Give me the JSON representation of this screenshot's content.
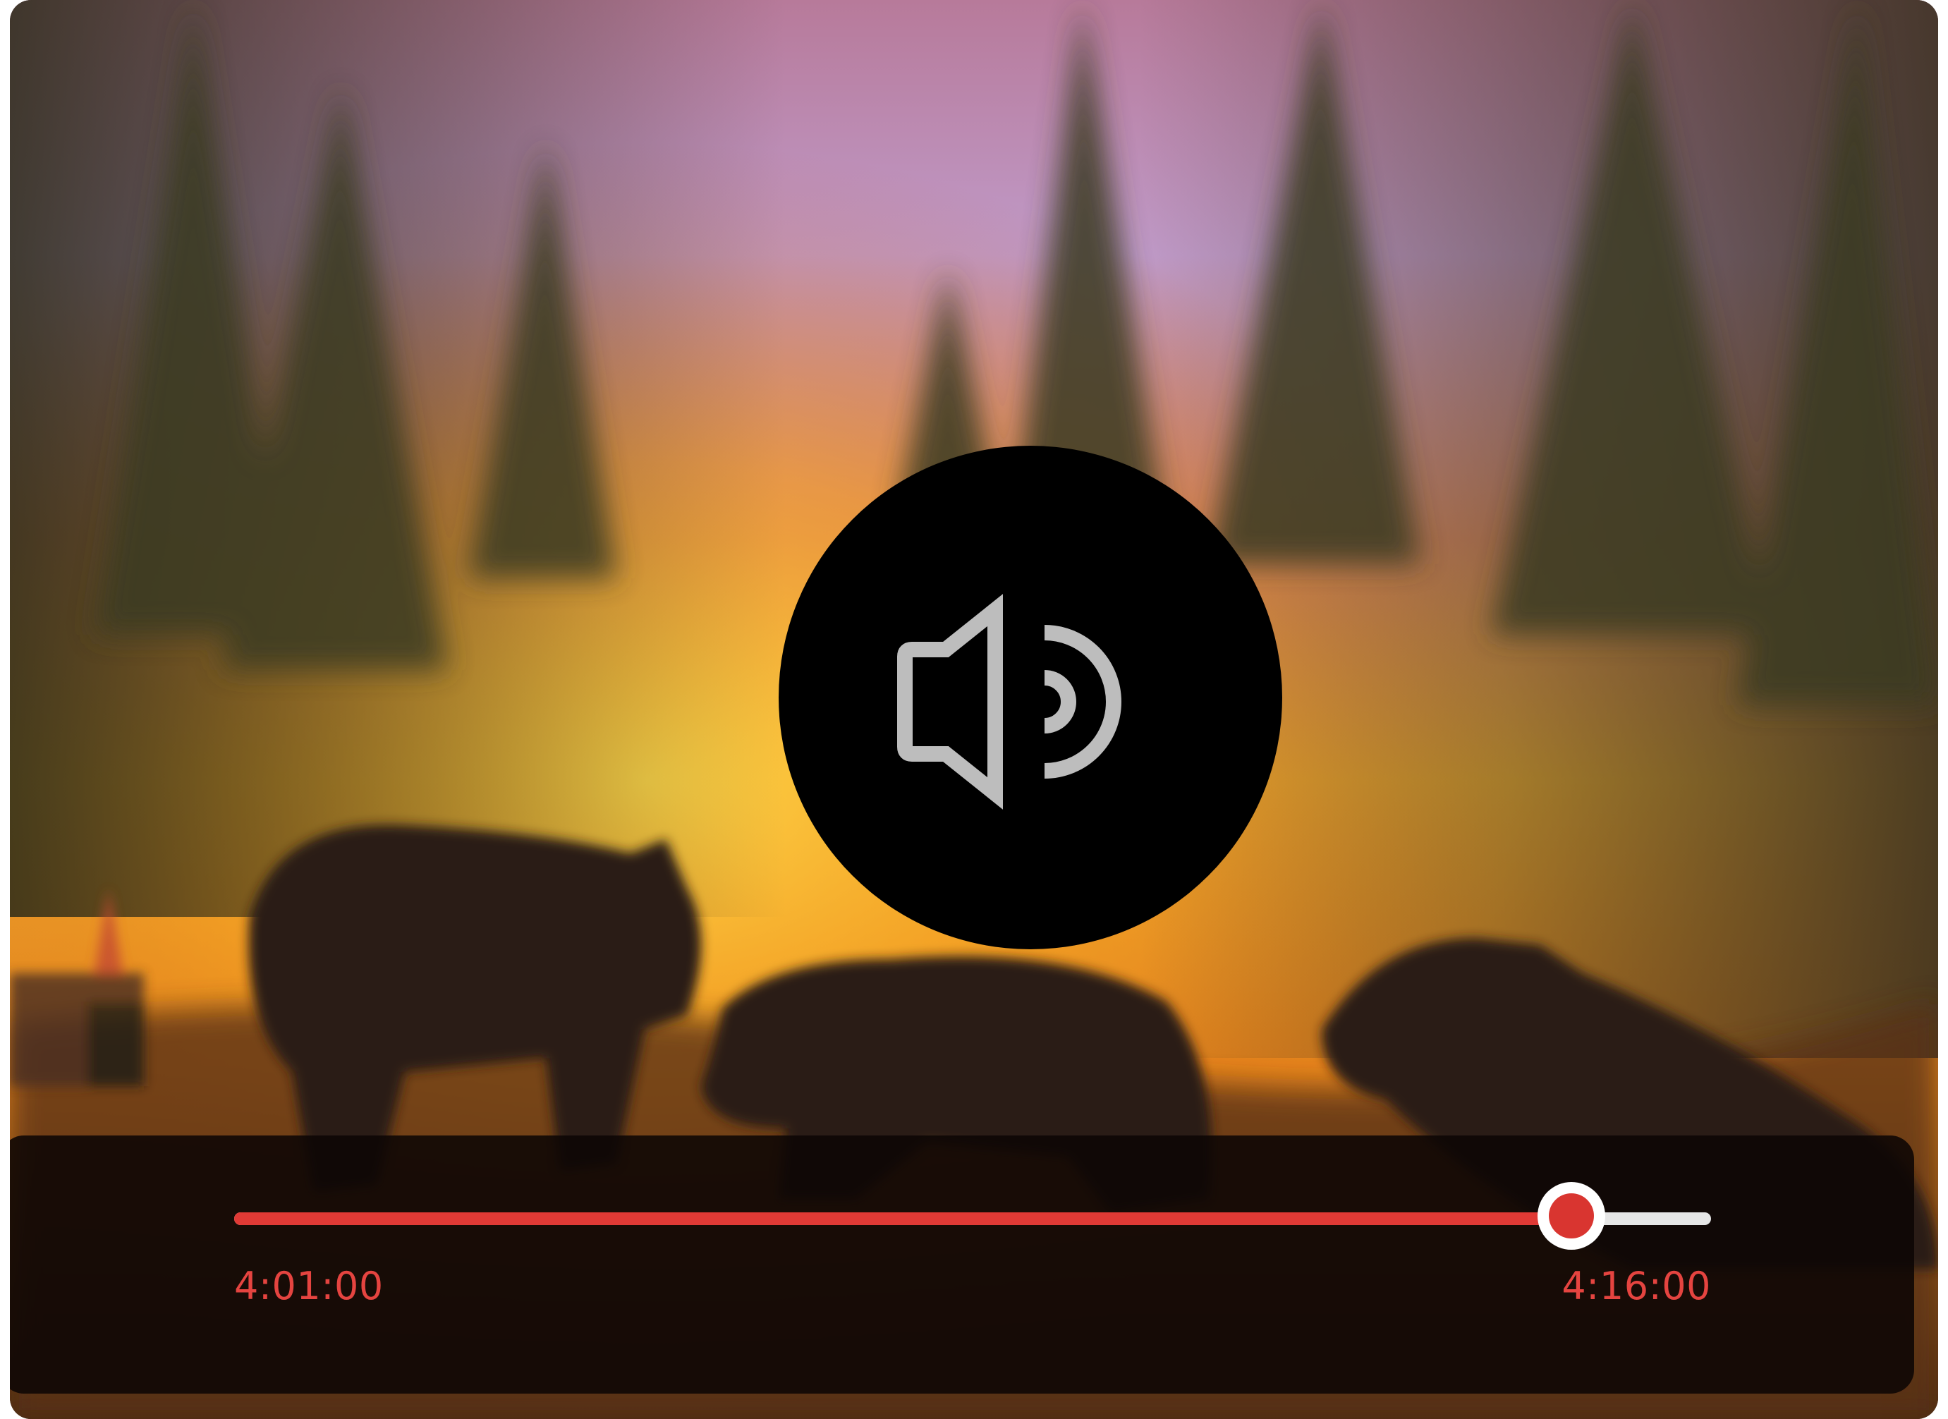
{
  "player": {
    "mute_icon": "speaker-volume-icon",
    "progress": {
      "fraction": 0.9053,
      "elapsed": "4:01:00",
      "total": "4:16:00"
    }
  },
  "colors": {
    "accent": "#e03a35",
    "track": "#e6e6e6",
    "icon": "#bdbdbd",
    "time_text": "#e54440"
  }
}
